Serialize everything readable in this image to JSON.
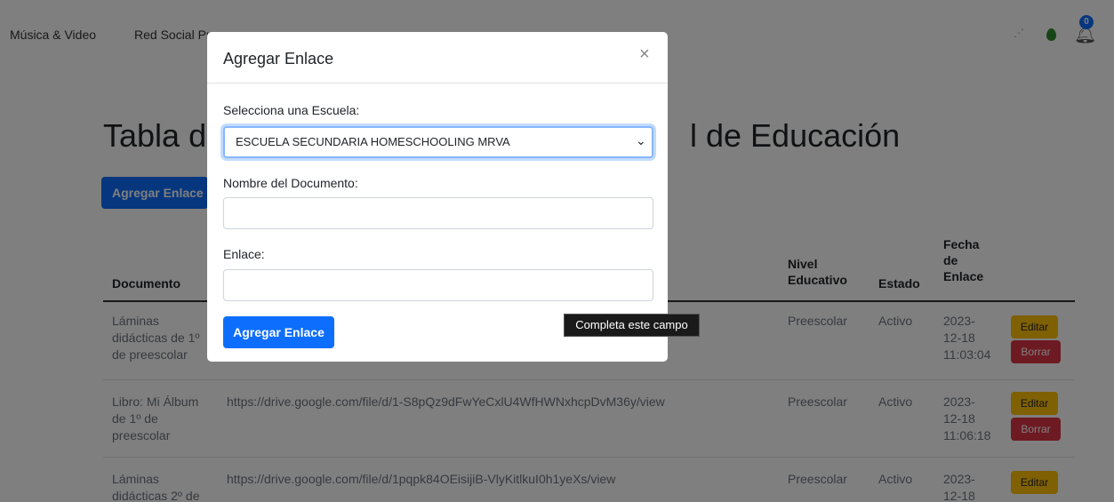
{
  "nav": {
    "items": [
      "Música & Video",
      "Red Social Pr"
    ],
    "notification_count": "0"
  },
  "page": {
    "title_left": "Tabla d",
    "title_right": "l de Educación",
    "add_button": "Agregar Enlace"
  },
  "table": {
    "headers": {
      "documento": "Documento",
      "nivel": [
        "Nivel",
        "Educativo"
      ],
      "estado": "Estado",
      "fecha": [
        "Fecha",
        "de",
        "Enlace"
      ]
    },
    "rows": [
      {
        "documento": [
          "Láminas",
          "didácticas de 1º",
          "de preescolar"
        ],
        "enlace": "",
        "nivel": "Preescolar",
        "estado": "Activo",
        "fecha": [
          "2023-",
          "12-18",
          "11:03:04"
        ]
      },
      {
        "documento": [
          "Libro: Mi Álbum",
          "de 1º de",
          "preescolar"
        ],
        "enlace": "https://drive.google.com/file/d/1-S8pQz9dFwYeCxlU4WfHWNxhcpDvM36y/view",
        "nivel": "Preescolar",
        "estado": "Activo",
        "fecha": [
          "2023-",
          "12-18",
          "11:06:18"
        ]
      },
      {
        "documento": [
          "Láminas",
          "didácticas 2º de"
        ],
        "enlace": "https://drive.google.com/file/d/1pqpk84OEisijiB-VlyKitlkuI0h1yeXs/view",
        "nivel": "Preescolar",
        "estado": "Activo",
        "fecha": [
          "2023-",
          "12-18"
        ]
      }
    ],
    "edit_label": "Editar",
    "delete_label": "Borrar"
  },
  "modal": {
    "title": "Agregar Enlace",
    "close_symbol": "×",
    "school_label": "Selecciona una Escuela:",
    "school_selected": "ESCUELA SECUNDARIA HOMESCHOOLING MRVA",
    "document_label": "Nombre del Documento:",
    "document_value": "",
    "link_label": "Enlace:",
    "link_value": "",
    "submit_label": "Agregar Enlace"
  },
  "tooltip": {
    "text": "Completa este campo"
  },
  "colors": {
    "primary": "#0d6efd",
    "warning": "#ffc107",
    "danger": "#dc3545"
  }
}
